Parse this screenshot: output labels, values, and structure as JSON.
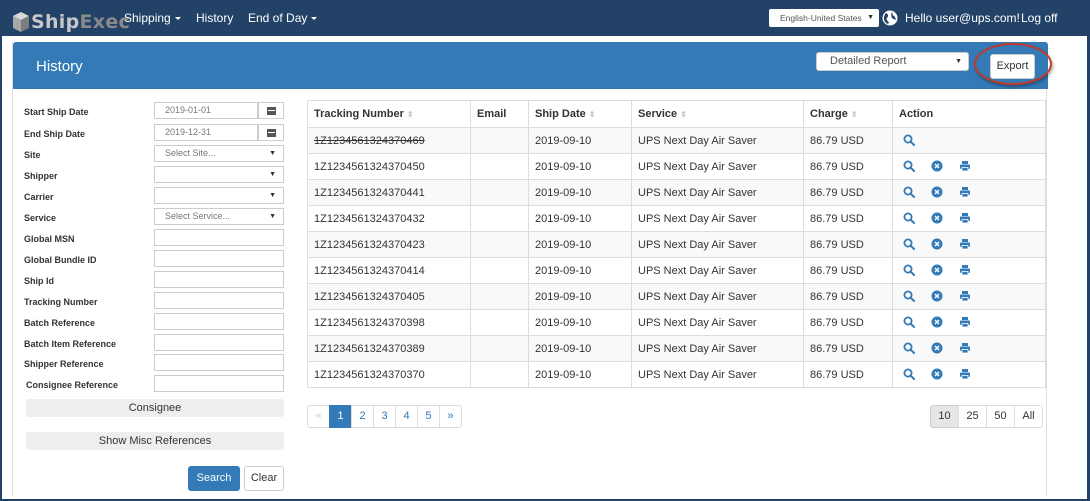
{
  "navbar": {
    "logo_part1": "Ship",
    "logo_part2": "Exec",
    "items": [
      {
        "label": "Shipping",
        "dropdown": true
      },
      {
        "label": "History",
        "dropdown": false
      },
      {
        "label": "End of Day",
        "dropdown": true
      }
    ],
    "language": "English-United States",
    "greeting": "Hello user@ups.com!",
    "logoff": "Log off"
  },
  "panel": {
    "title": "History",
    "report_type": "Detailed Report",
    "export_label": "Export"
  },
  "filters": {
    "start_ship_date": {
      "label": "Start Ship Date",
      "value": "2019-01-01"
    },
    "end_ship_date": {
      "label": "End Ship Date",
      "value": "2019-12-31"
    },
    "site": {
      "label": "Site",
      "placeholder": "Select Site..."
    },
    "shipper": {
      "label": "Shipper",
      "value": ""
    },
    "carrier": {
      "label": "Carrier",
      "value": ""
    },
    "service": {
      "label": "Service",
      "placeholder": "Select Service..."
    },
    "global_msn": {
      "label": "Global MSN",
      "value": ""
    },
    "global_bundle_id": {
      "label": "Global Bundle ID",
      "value": ""
    },
    "ship_id": {
      "label": "Ship Id",
      "value": ""
    },
    "tracking_number": {
      "label": "Tracking Number",
      "value": ""
    },
    "batch_reference": {
      "label": "Batch Reference",
      "value": ""
    },
    "batch_item_reference": {
      "label": "Batch Item Reference",
      "value": ""
    },
    "shipper_reference": {
      "label": "Shipper Reference",
      "value": ""
    },
    "consignee_reference": {
      "label": "Consignee Reference",
      "value": ""
    },
    "consignee_button": "Consignee",
    "misc_button": "Show Misc References",
    "search_button": "Search",
    "clear_button": "Clear"
  },
  "table": {
    "headers": [
      "Tracking Number",
      "Email",
      "Ship Date",
      "Service",
      "Charge",
      "Action"
    ],
    "sort_icon": "⬍",
    "rows": [
      {
        "tracking": "1Z1234561324370469",
        "email": "",
        "ship_date": "2019-09-10",
        "service": "UPS Next Day Air Saver",
        "charge": "86.79 USD",
        "voided": true
      },
      {
        "tracking": "1Z1234561324370450",
        "email": "",
        "ship_date": "2019-09-10",
        "service": "UPS Next Day Air Saver",
        "charge": "86.79 USD",
        "voided": false
      },
      {
        "tracking": "1Z1234561324370441",
        "email": "",
        "ship_date": "2019-09-10",
        "service": "UPS Next Day Air Saver",
        "charge": "86.79 USD",
        "voided": false
      },
      {
        "tracking": "1Z1234561324370432",
        "email": "",
        "ship_date": "2019-09-10",
        "service": "UPS Next Day Air Saver",
        "charge": "86.79 USD",
        "voided": false
      },
      {
        "tracking": "1Z1234561324370423",
        "email": "",
        "ship_date": "2019-09-10",
        "service": "UPS Next Day Air Saver",
        "charge": "86.79 USD",
        "voided": false
      },
      {
        "tracking": "1Z1234561324370414",
        "email": "",
        "ship_date": "2019-09-10",
        "service": "UPS Next Day Air Saver",
        "charge": "86.79 USD",
        "voided": false
      },
      {
        "tracking": "1Z1234561324370405",
        "email": "",
        "ship_date": "2019-09-10",
        "service": "UPS Next Day Air Saver",
        "charge": "86.79 USD",
        "voided": false
      },
      {
        "tracking": "1Z1234561324370398",
        "email": "",
        "ship_date": "2019-09-10",
        "service": "UPS Next Day Air Saver",
        "charge": "86.79 USD",
        "voided": false
      },
      {
        "tracking": "1Z1234561324370389",
        "email": "",
        "ship_date": "2019-09-10",
        "service": "UPS Next Day Air Saver",
        "charge": "86.79 USD",
        "voided": false
      },
      {
        "tracking": "1Z1234561324370370",
        "email": "",
        "ship_date": "2019-09-10",
        "service": "UPS Next Day Air Saver",
        "charge": "86.79 USD",
        "voided": false
      }
    ]
  },
  "pagination": {
    "prev": "«",
    "next": "»",
    "pages": [
      "1",
      "2",
      "3",
      "4",
      "5"
    ],
    "current": "1"
  },
  "page_size": {
    "options": [
      "10",
      "25",
      "50",
      "All"
    ],
    "selected": "10"
  },
  "colors": {
    "navbar": "#234268",
    "primary": "#337ab7",
    "highlight_circle": "#c0392b"
  }
}
